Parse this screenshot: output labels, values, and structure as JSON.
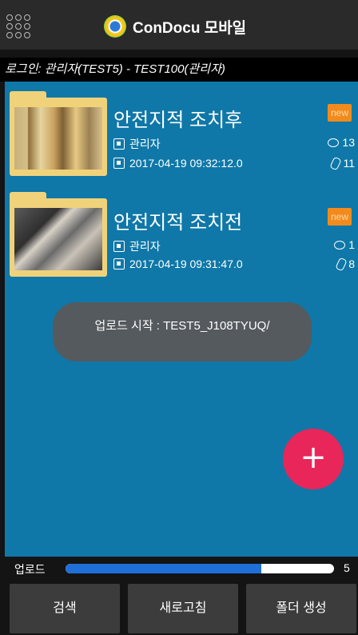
{
  "header": {
    "title": "ConDocu 모바일",
    "menu_icon": "grid-menu-icon",
    "logo_icon": "condocu-logo-icon"
  },
  "login": {
    "text": "로그인: 관리자(TEST5) - TEST100(관리자)"
  },
  "items": [
    {
      "title": "안전지적 조치후",
      "author": "관리자",
      "datetime": "2017-04-19 09:32:12.0",
      "badge": "new",
      "comments": "13",
      "attachments": "11"
    },
    {
      "title": "안전지적 조치전",
      "author": "관리자",
      "datetime": "2017-04-19 09:31:47.0",
      "badge": "new",
      "comments": "1",
      "attachments": "8"
    }
  ],
  "toast": {
    "text": "업로드 시작 : TEST5_J108TYUQ/"
  },
  "fab": {
    "label": "+"
  },
  "upload": {
    "label": "업로드",
    "count": "5",
    "progress": 0.73
  },
  "bottom": {
    "search": "검색",
    "refresh": "새로고침",
    "create_folder": "폴더 생성"
  },
  "colors": {
    "content_bg": "#0f78a8",
    "badge": "#f28b1c",
    "fab": "#e8265a",
    "progress": "#1f6fd9"
  }
}
